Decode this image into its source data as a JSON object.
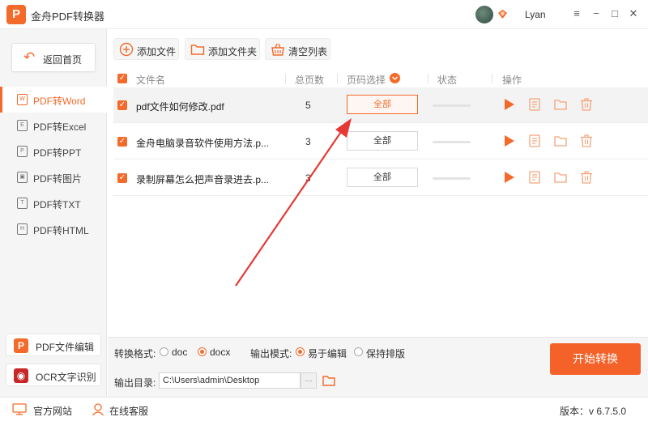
{
  "app": {
    "logo": "P",
    "title": "金舟PDF转换器",
    "username": "Lyan"
  },
  "window_controls": [
    "≡",
    "−",
    "□",
    "✕"
  ],
  "sidebar": {
    "back_label": "返回首页",
    "items": [
      {
        "label": "PDF转Word",
        "icon_text": "W",
        "active": true
      },
      {
        "label": "PDF转Excel",
        "icon_text": "E",
        "active": false
      },
      {
        "label": "PDF转PPT",
        "icon_text": "P",
        "active": false
      },
      {
        "label": "PDF转图片",
        "icon_text": "▣",
        "active": false
      },
      {
        "label": "PDF转TXT",
        "icon_text": "T",
        "active": false
      },
      {
        "label": "PDF转HTML",
        "icon_text": "H",
        "active": false
      }
    ],
    "tools": [
      {
        "label": "PDF文件编辑",
        "icon_text": "P",
        "color": "#f46a2a"
      },
      {
        "label": "OCR文字识别",
        "icon_text": "◉",
        "color": "#c62828"
      }
    ]
  },
  "toolbar": {
    "add_file": "添加文件",
    "add_folder": "添加文件夹",
    "clear_list": "清空列表"
  },
  "table": {
    "headers": {
      "filename": "文件名",
      "pages": "总页数",
      "page_select": "页码选择",
      "status": "状态",
      "actions": "操作"
    },
    "rows": [
      {
        "name": "pdf文件如何修改.pdf",
        "pages": "5",
        "page_select": "全部",
        "checked": true,
        "selected": true,
        "highlighted": true
      },
      {
        "name": "金舟电脑录音软件使用方法.p...",
        "pages": "3",
        "page_select": "全部",
        "checked": true,
        "selected": false,
        "highlighted": false
      },
      {
        "name": "录制屏幕怎么把声音录进去.p...",
        "pages": "3",
        "page_select": "全部",
        "checked": true,
        "selected": false,
        "highlighted": false
      }
    ]
  },
  "options": {
    "format_label": "转换格式:",
    "format_options": [
      "doc",
      "docx"
    ],
    "format_selected": "docx",
    "mode_label": "输出模式:",
    "mode_options": [
      "易于编辑",
      "保持排版"
    ],
    "mode_selected": "易于编辑",
    "output_dir_label": "输出目录:",
    "output_dir_value": "C:\\Users\\admin\\Desktop",
    "browse_label": "···",
    "start_label": "开始转换"
  },
  "statusbar": {
    "website": "官方网站",
    "support": "在线客服",
    "version": "版本：v 6.7.5.0"
  },
  "colors": {
    "accent": "#f46a2a",
    "start_button": "#f4622a",
    "annotation_arrow": "#e53935"
  }
}
